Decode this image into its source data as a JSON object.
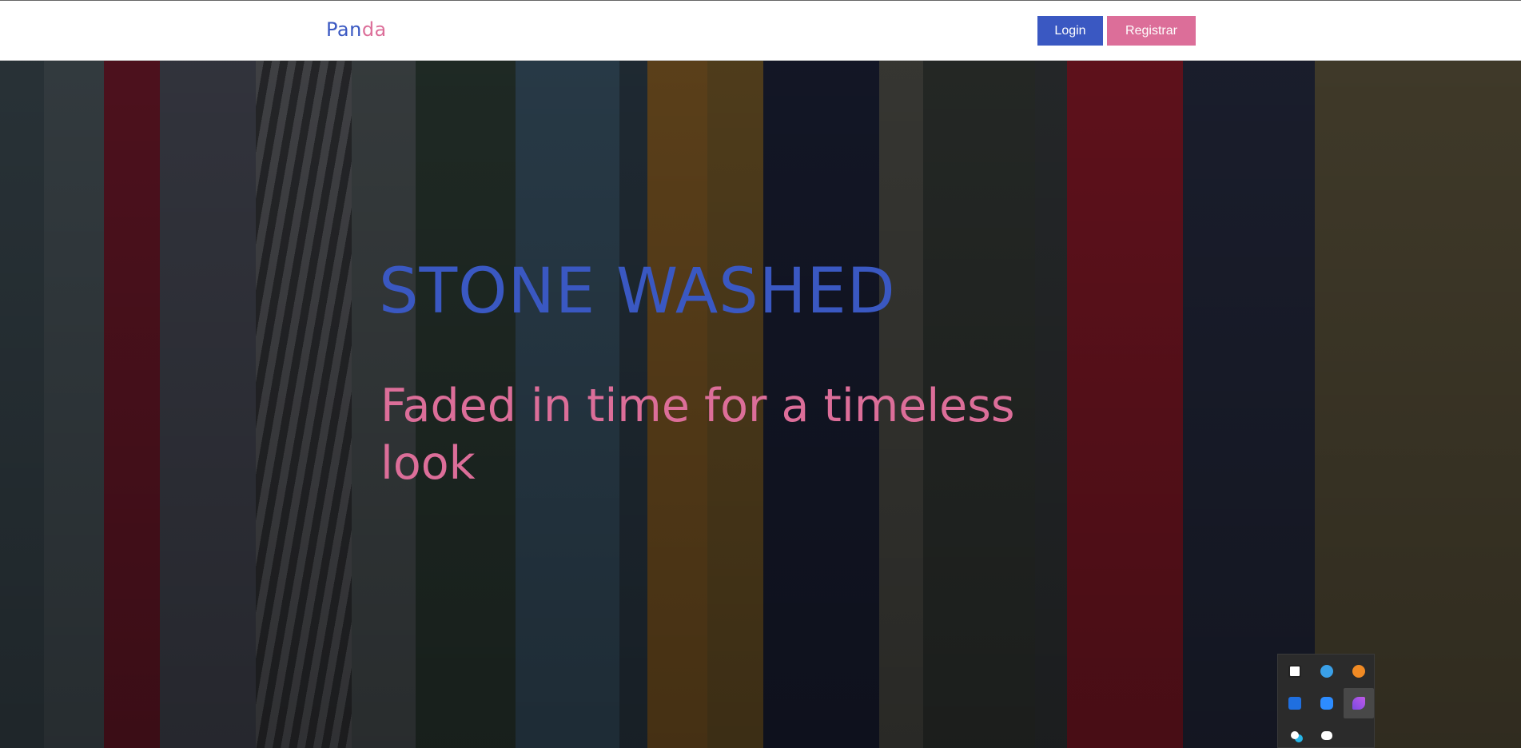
{
  "header": {
    "logo_part1": "Pan",
    "logo_part2": "da",
    "login_label": "Login",
    "register_label": "Registrar"
  },
  "hero": {
    "title": "STONE WASHED",
    "subtitle": "Faded in time for a timeless look"
  },
  "system_tray": {
    "icons": [
      "security-warning-icon",
      "browser-icon",
      "rss-icon",
      "audio-wave-icon",
      "video-meeting-icon",
      "feather-icon",
      "sync-icon",
      "discord-icon"
    ]
  },
  "colors": {
    "primary": "#3a58c2",
    "accent": "#dc6e99"
  }
}
